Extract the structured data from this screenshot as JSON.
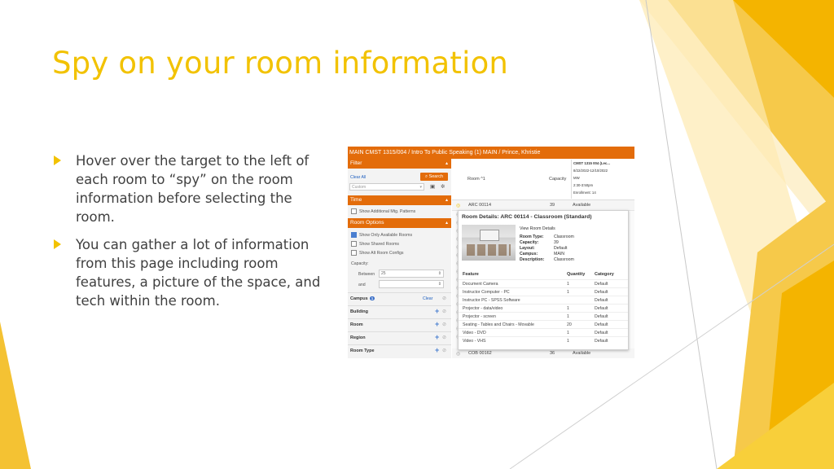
{
  "slide": {
    "title": "Spy on your room information",
    "bullets": [
      "Hover over the target to the left of each room to “spy” on the room information before selecting the room.",
      "You can gather a lot of information from this page including room features, a picture of the space, and tech within the room."
    ],
    "accent_color": "#f2c200"
  },
  "screenshot": {
    "header": "MAIN CMST 1315/004 / Intro To Public Speaking (1) MAIN / Prince, Khristie",
    "filter": {
      "title": "Filter",
      "clear_all": "Clear All",
      "search_label": "Search",
      "preset": "Custom"
    },
    "time": {
      "title": "Time",
      "option": "Show Additional Mtg. Patterns"
    },
    "room_options": {
      "title": "Room Options",
      "checkboxes": [
        {
          "label": "Show Only Available Rooms",
          "checked": true
        },
        {
          "label": "Show Shared Rooms",
          "checked": false
        },
        {
          "label": "Show Alt Room Configs",
          "checked": false
        }
      ],
      "capacity_label": "Capacity:",
      "between_label": "Between",
      "between_value": "25",
      "and_label": "and",
      "and_value": ""
    },
    "filters": [
      {
        "label": "Campus",
        "badge": "1",
        "clear": "Clear"
      },
      {
        "label": "Building"
      },
      {
        "label": "Room"
      },
      {
        "label": "Region"
      },
      {
        "label": "Room Type"
      }
    ],
    "columns": {
      "room": "Room ^1",
      "capacity": "Capacity"
    },
    "section_tip": {
      "line1": "CMST 1315 004 (Lec...",
      "line2": "8/22/2022-12/10/2022",
      "line3": "MW",
      "line4": "2:30-3:50pm",
      "line5": "Enrollment: 14"
    },
    "rows": [
      {
        "room": "ARC 00114",
        "capacity": "39",
        "status": "Available"
      },
      {
        "room": "COB 00162",
        "capacity": "36",
        "status": "Available"
      }
    ],
    "popup": {
      "title": "Room Details: ARC 00114 - Classroom (Standard)",
      "view_link": "View Room Details",
      "details": [
        {
          "label": "Room Type:",
          "value": "Classroom"
        },
        {
          "label": "Capacity:",
          "value": "39"
        },
        {
          "label": "Layout:",
          "value": "Default"
        },
        {
          "label": "Campus:",
          "value": "MAIN"
        },
        {
          "label": "Description:",
          "value": "Classroom"
        }
      ],
      "feature_headers": {
        "feature": "Feature",
        "quantity": "Quantity",
        "category": "Category"
      },
      "features": [
        {
          "feature": "Document Camera",
          "quantity": "1",
          "category": "Default"
        },
        {
          "feature": "Instructor Computer - PC",
          "quantity": "1",
          "category": "Default"
        },
        {
          "feature": "Instructor PC - SPSS Software",
          "quantity": "",
          "category": "Default"
        },
        {
          "feature": "Projector - data/video",
          "quantity": "1",
          "category": "Default"
        },
        {
          "feature": "Projector - screen",
          "quantity": "1",
          "category": "Default"
        },
        {
          "feature": "Seating - Tables and Chairs - Movable",
          "quantity": "20",
          "category": "Default"
        },
        {
          "feature": "Video - DVD",
          "quantity": "1",
          "category": "Default"
        },
        {
          "feature": "Video - VHS",
          "quantity": "1",
          "category": "Default"
        }
      ]
    }
  }
}
